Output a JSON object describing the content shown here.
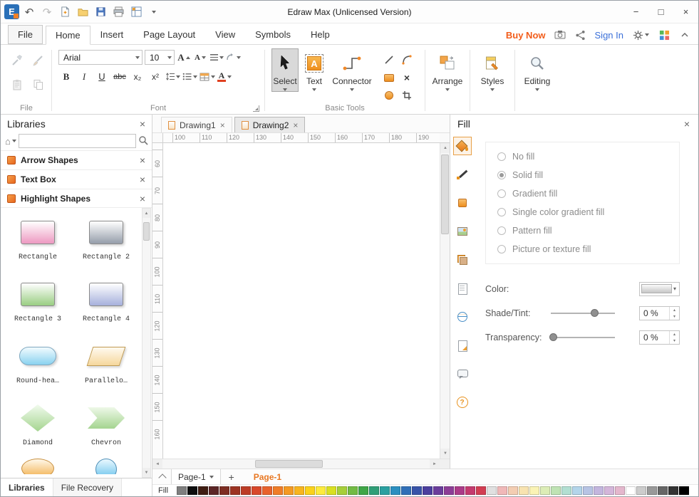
{
  "titlebar": {
    "title": "Edraw Max (Unlicensed Version)",
    "minimize": "−",
    "maximize": "□",
    "close": "×"
  },
  "menubar": {
    "tabs": [
      {
        "label": "File",
        "cls": "file"
      },
      {
        "label": "Home",
        "cls": "active"
      },
      {
        "label": "Insert"
      },
      {
        "label": "Page Layout"
      },
      {
        "label": "View"
      },
      {
        "label": "Symbols"
      },
      {
        "label": "Help"
      }
    ],
    "buy_now": "Buy Now",
    "sign_in": "Sign In"
  },
  "ribbon": {
    "file_group_label": "File",
    "font_group_label": "Font",
    "basic_tools_label": "Basic Tools",
    "font_family": "Arial",
    "font_size": "10",
    "bold": "B",
    "italic": "I",
    "underline": "U",
    "strike": "abc",
    "subscript": "x₂",
    "superscript": "x²",
    "grow_font": "A",
    "shrink_font": "A",
    "font_color": "A",
    "select_label": "Select",
    "text_label": "Text",
    "text_icon_letter": "A",
    "connector_label": "Connector",
    "arrange_label": "Arrange",
    "styles_label": "Styles",
    "editing_label": "Editing"
  },
  "libraries": {
    "title": "Libraries",
    "sections": [
      {
        "title": "Arrow Shapes"
      },
      {
        "title": "Text Box"
      },
      {
        "title": "Highlight Shapes"
      }
    ],
    "shapes": [
      {
        "label": "Rectangle",
        "type": "rect",
        "color": "#ee9ec4"
      },
      {
        "label": "Rectangle 2",
        "type": "rect",
        "color": "#9aa2ae"
      },
      {
        "label": "Rectangle 3",
        "type": "rect",
        "color": "#9ed088"
      },
      {
        "label": "Rectangle 4",
        "type": "rect",
        "color": "#aab4de"
      },
      {
        "label": "Round-hea…",
        "type": "pill",
        "color": "#8fd4f0"
      },
      {
        "label": "Parallelo…",
        "type": "parallelogram",
        "color": "#f6d9a0"
      },
      {
        "label": "Diamond",
        "type": "diamond",
        "color": "#a8d694"
      },
      {
        "label": "Chevron",
        "type": "chevron",
        "color": "#a8d694"
      }
    ],
    "partial_shapes": [
      {
        "type": "pellipse",
        "color": "#f2b04e"
      },
      {
        "type": "pcircle",
        "color": "#66c2ec"
      }
    ],
    "bottom_tabs": [
      {
        "label": "Libraries",
        "cls": "active"
      },
      {
        "label": "File Recovery"
      }
    ]
  },
  "canvas": {
    "doc_tabs": [
      {
        "label": "Drawing1"
      },
      {
        "label": "Drawing2",
        "cls": "active"
      }
    ],
    "h_ruler": [
      "100",
      "110",
      "120",
      "130",
      "140",
      "150",
      "160",
      "170",
      "180",
      "190"
    ],
    "v_ruler": [
      "60",
      "70",
      "80",
      "90",
      "100",
      "110",
      "120",
      "130",
      "140",
      "150",
      "160"
    ],
    "page_tab": "Page-1",
    "add_page": "+",
    "current_page": "Page-1",
    "fill_strip_label": "Fill",
    "palette": [
      "#7f7f7f",
      "#0d0d0d",
      "#3f1d12",
      "#5b2626",
      "#7d2e23",
      "#9c3322",
      "#bc3c26",
      "#d8482b",
      "#e8622c",
      "#ef7d28",
      "#f49a23",
      "#f8b51e",
      "#fbd21a",
      "#fdeb3c",
      "#d9e021",
      "#a6cf39",
      "#72bb44",
      "#3fa647",
      "#2f9e77",
      "#2aa0a0",
      "#2b8fc0",
      "#2f6fb7",
      "#3753a8",
      "#4b3f9e",
      "#6a3d9b",
      "#8c3d96",
      "#ab3b88",
      "#c43a6e",
      "#d23d52",
      "#e0e0e0",
      "#f0b8b8",
      "#f3cdb2",
      "#f8e3b0",
      "#faf3b5",
      "#dcedb6",
      "#bfe3b4",
      "#b2dfd2",
      "#b3d5ea",
      "#b7c4e4",
      "#c3b6de",
      "#d4b6da",
      "#e4b7cd",
      "#ffffff",
      "#cccccc",
      "#999999",
      "#666666",
      "#333333",
      "#000000"
    ]
  },
  "side_icons": [
    {
      "name": "fill-icon",
      "cls": "ic-fill",
      "active": "active"
    },
    {
      "name": "line-icon",
      "cls": "ic-line"
    },
    {
      "name": "shape-icon",
      "cls": "ic-shape"
    },
    {
      "name": "picture-icon",
      "cls": "ic-picture"
    },
    {
      "name": "theme-icon",
      "cls": "ic-theme"
    },
    {
      "name": "page-setup-icon",
      "cls": "ic-page"
    },
    {
      "name": "hyperlink-icon",
      "cls": "ic-link"
    },
    {
      "name": "attachment-icon",
      "cls": "ic-note"
    },
    {
      "name": "comment-icon",
      "cls": "ic-comment"
    },
    {
      "name": "help-icon",
      "cls": "ic-help"
    }
  ],
  "fill_panel": {
    "title": "Fill",
    "options": [
      {
        "label": "No fill"
      },
      {
        "label": "Solid fill",
        "cls": "selected"
      },
      {
        "label": "Gradient fill"
      },
      {
        "label": "Single color gradient fill"
      },
      {
        "label": "Pattern fill"
      },
      {
        "label": "Picture or texture fill"
      }
    ],
    "color_label": "Color:",
    "shade_label": "Shade/Tint:",
    "shade_value": "0 %",
    "shade_pos": "68%",
    "transparency_label": "Transparency:",
    "transparency_value": "0 %",
    "transparency_pos": "3%"
  }
}
